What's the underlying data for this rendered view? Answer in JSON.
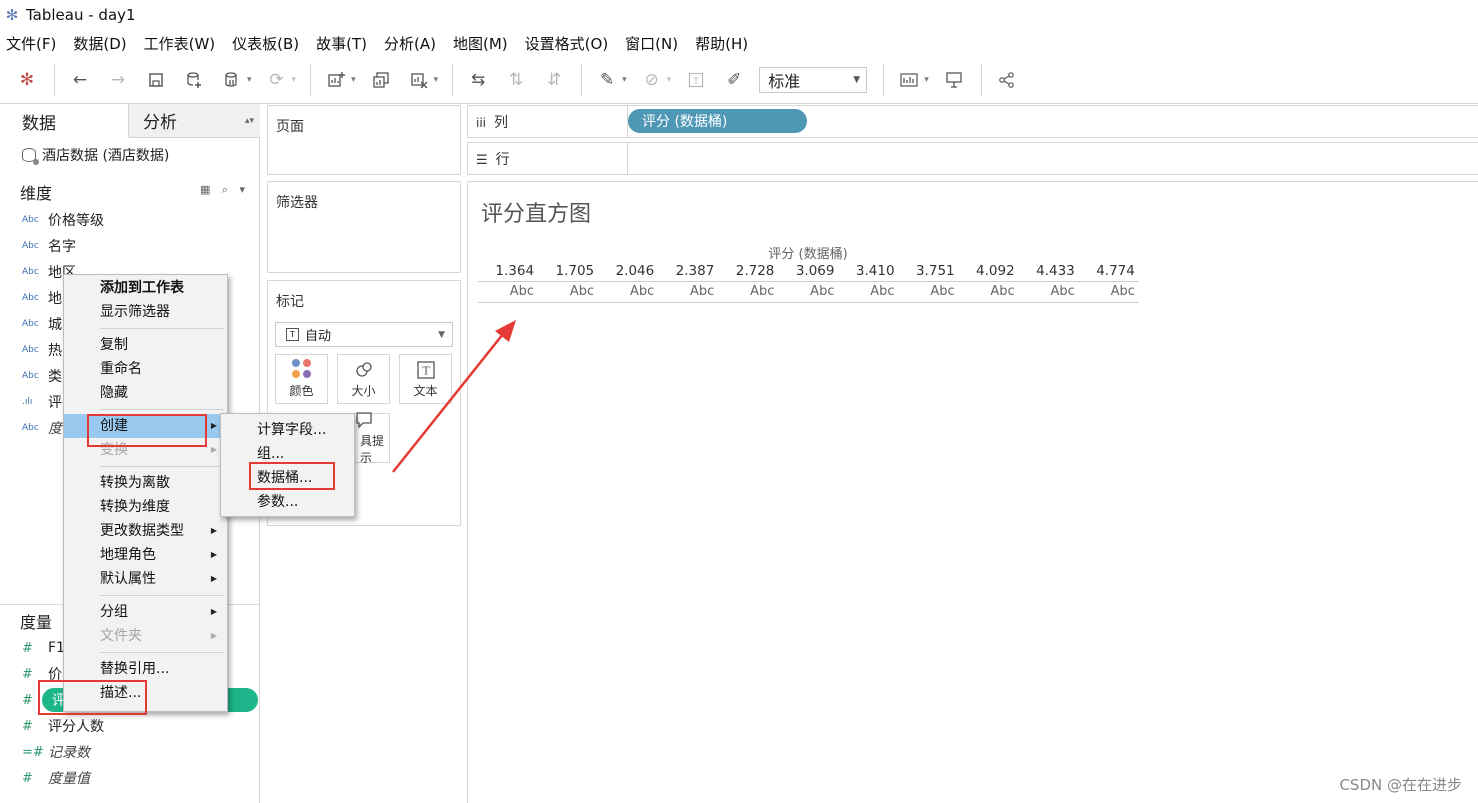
{
  "window": {
    "title": "Tableau - day1"
  },
  "menubar": [
    "文件(F)",
    "数据(D)",
    "工作表(W)",
    "仪表板(B)",
    "故事(T)",
    "分析(A)",
    "地图(M)",
    "设置格式(O)",
    "窗口(N)",
    "帮助(H)"
  ],
  "toolbar": {
    "show_me_select": "标准"
  },
  "left_pane": {
    "tabs": {
      "data": "数据",
      "analysis": "分析"
    },
    "datasource": "酒店数据 (酒店数据)",
    "dimensions_header": "维度",
    "dimensions": [
      {
        "type": "Abc",
        "name": "价格等级"
      },
      {
        "type": "Abc",
        "name": "名字"
      },
      {
        "type": "Abc",
        "name": "地区"
      },
      {
        "type": "Abc",
        "name": "地"
      },
      {
        "type": "Abc",
        "name": "城"
      },
      {
        "type": "Abc",
        "name": "热"
      },
      {
        "type": "Abc",
        "name": "类"
      },
      {
        "type": ".ılı",
        "name": "评"
      },
      {
        "type": "Abc",
        "name": "度"
      }
    ],
    "measures_header": "度量",
    "measures": [
      {
        "type": "#",
        "name": "F1"
      },
      {
        "type": "#",
        "name": "价"
      },
      {
        "type": "#",
        "name": "评"
      },
      {
        "type": "#",
        "name": "评分人数"
      },
      {
        "type": "=#",
        "name": "记录数"
      },
      {
        "type": "#",
        "name": "度量值"
      }
    ]
  },
  "cards": {
    "pages": "页面",
    "filters": "筛选器",
    "marks": "标记",
    "mark_type": "自动",
    "mark_buttons": [
      {
        "icon": "color",
        "label": "颜色"
      },
      {
        "icon": "size",
        "label": "大小"
      },
      {
        "icon": "text",
        "label": "文本"
      },
      {
        "icon": "tooltip",
        "label": "具提示"
      }
    ]
  },
  "shelves": {
    "columns_label": "列",
    "rows_label": "行",
    "columns_pill": "评分 (数据桶)"
  },
  "view": {
    "title": "评分直方图",
    "header": "评分 (数据桶)",
    "bins": [
      "1.364",
      "1.705",
      "2.046",
      "2.387",
      "2.728",
      "3.069",
      "3.410",
      "3.751",
      "4.092",
      "4.433",
      "4.774"
    ],
    "cell_text": "Abc"
  },
  "context_menu": {
    "items": [
      "添加到工作表",
      "显示筛选器",
      "复制",
      "重命名",
      "隐藏",
      "创建",
      "变换",
      "转换为离散",
      "转换为维度",
      "更改数据类型",
      "地理角色",
      "默认属性",
      "分组",
      "文件夹",
      "替换引用...",
      "描述..."
    ]
  },
  "submenu": {
    "items": [
      "计算字段...",
      "组...",
      "数据桶...",
      "参数..."
    ]
  },
  "watermark": "CSDN @在在进步",
  "colors": {
    "dimension_icon": "#3a6fb0",
    "measure_pill": "#1fb58a",
    "column_pill": "#4e97b5",
    "menu_highlight": "#99c9ee",
    "annotation_red": "#e53935"
  }
}
